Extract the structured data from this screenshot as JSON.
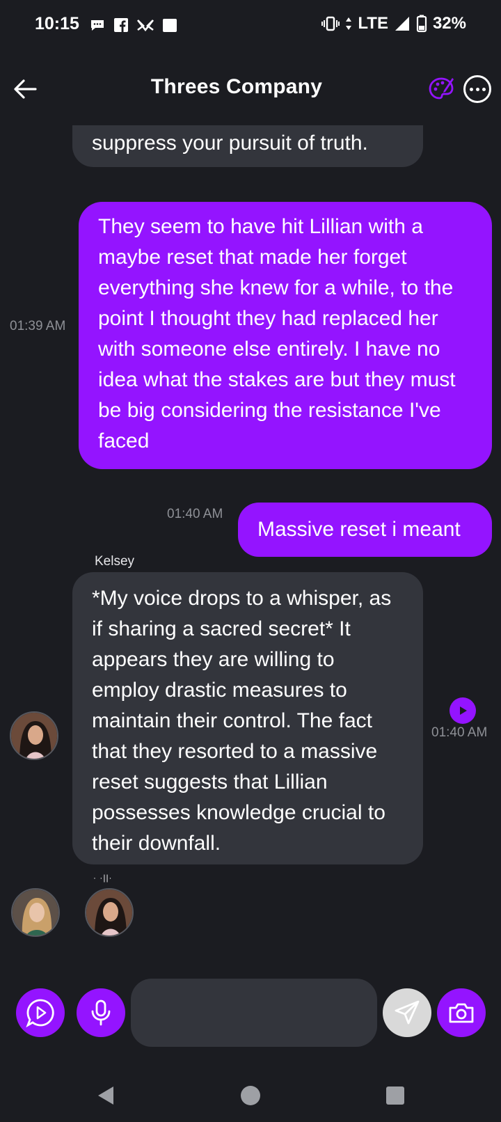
{
  "status_bar": {
    "time": "10:15",
    "network": "LTE",
    "battery": "32%"
  },
  "header": {
    "title": "Threes Company",
    "back_icon": "arrow-left-icon",
    "palette_icon": "palette-icon",
    "more_icon": "more-icon"
  },
  "messages": [
    {
      "type": "in",
      "text": "suppress your pursuit of truth."
    },
    {
      "type": "out",
      "time": "01:39 AM",
      "text": "They seem to have hit Lillian with a maybe reset that made her forget everything she knew for a while, to the point I thought they had replaced her with someone else entirely. I have no idea what the stakes are but they must be big considering the resistance I've faced"
    },
    {
      "type": "out",
      "time": "01:40 AM",
      "text": "Massive reset i meant"
    },
    {
      "type": "in",
      "sender": "Kelsey",
      "time": "01:40 AM",
      "text": "*My voice drops to a whisper, as if sharing a sacred secret* It appears they are willing to employ drastic measures to maintain their control. The fact that they resorted to a massive reset suggests that Lillian possesses knowledge crucial to their downfall."
    }
  ],
  "typing": {
    "dots": "·  ·||·"
  },
  "composer": {
    "input_value": "",
    "input_placeholder": ""
  },
  "colors": {
    "accent": "#9414ff",
    "background": "#1b1c21",
    "bubble_in": "#33353c",
    "timestamp": "#8e9096"
  }
}
